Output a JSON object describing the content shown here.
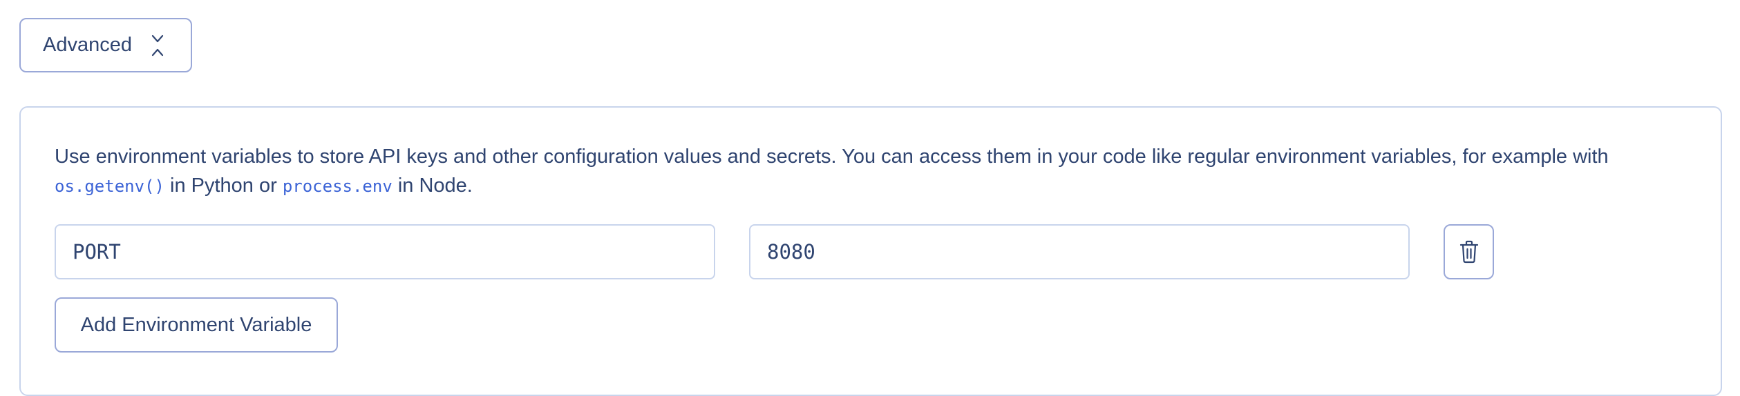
{
  "advanced_toggle": {
    "label": "Advanced",
    "icon": "chevrons-collapse-icon"
  },
  "env_panel": {
    "description": {
      "text_before": "Use environment variables to store API keys and other configuration values and secrets. You can access them in your code like regular environment variables, for example with ",
      "code_python": "os.getenv()",
      "text_middle": " in Python or ",
      "code_node": "process.env",
      "text_after": " in Node."
    },
    "variables": [
      {
        "key": "PORT",
        "value": "8080"
      }
    ],
    "delete_icon": "trash-icon",
    "add_button_label": "Add Environment Variable"
  },
  "colors": {
    "text": "#2f4470",
    "code": "#3b63d6",
    "button_border": "#9aa8d8",
    "panel_border": "#c8d4ec"
  }
}
